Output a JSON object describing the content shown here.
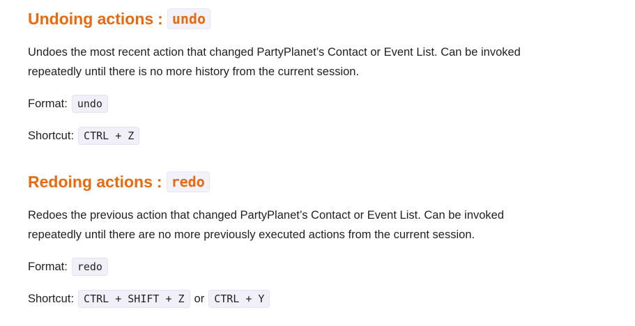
{
  "undo": {
    "heading_text": "Undoing actions",
    "heading_sep": ":",
    "heading_code": "undo",
    "desc_line1": "Undoes the most recent action that changed PartyPlanet’s Contact or Event List. Can be invoked",
    "desc_line2": "repeatedly until there is no more history from the current session.",
    "format_label": "Format:",
    "format_code": "undo",
    "shortcut_label": "Shortcut:",
    "shortcut_code": "CTRL + Z"
  },
  "redo": {
    "heading_text": "Redoing actions",
    "heading_sep": ":",
    "heading_code": "redo",
    "desc_line1": "Redoes the previous action that changed PartyPlanet’s Contact or Event List. Can be invoked",
    "desc_line2": "repeatedly until there are no more previously executed actions from the current session.",
    "format_label": "Format:",
    "format_code": "redo",
    "shortcut_label": "Shortcut:",
    "shortcut_code_1": "CTRL + SHIFT + Z",
    "shortcut_or": "or",
    "shortcut_code_2": "CTRL + Y"
  }
}
